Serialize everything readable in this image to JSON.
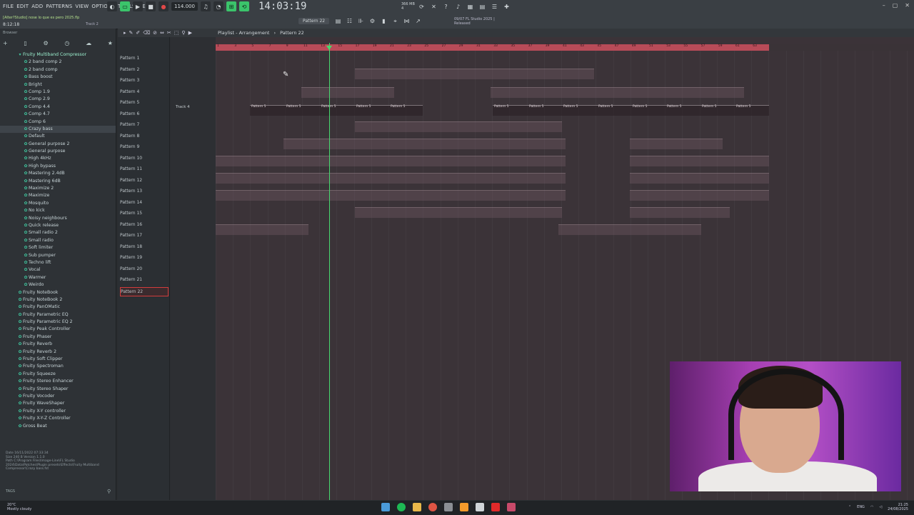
{
  "menu": [
    "FILE",
    "EDIT",
    "ADD",
    "PATTERNS",
    "VIEW",
    "OPTIONS",
    "TOOLS",
    "HELP"
  ],
  "hint": "[Alter?Studio] nose lo que es pero 2025.flp",
  "time_small": "8:12:18",
  "track_label_top": "Track 2",
  "tempo": "114.000",
  "clock": "14:03:19",
  "pattern_selector": "Pattern 22",
  "cpu": [
    "366 MB",
    "4"
  ],
  "news": [
    "09/07 FL Studio 2025 |",
    "Released"
  ],
  "browser": {
    "title": "Browser",
    "head_item": "Fruity Multiband Compressor",
    "presets": [
      "2 band comp 2",
      "2 band comp",
      "Bass boost",
      "Bright",
      "Comp 1.9",
      "Comp 2.9",
      "Comp 4.4",
      "Comp 4.7",
      "Comp 6",
      "Crazy bass",
      "Default",
      "General purpose 2",
      "General purpose",
      "High 4kHz",
      "High bypass",
      "Mastering 2.4dB",
      "Mastering 6dB",
      "Maximize 2",
      "Maximize",
      "Mosquito",
      "No kick",
      "Noisy neighbours",
      "Quick release",
      "Small radio 2",
      "Small radio",
      "Soft limiter",
      "Sub pumper",
      "Techno lift",
      "Vocal",
      "Warmer",
      "Weirdo"
    ],
    "selected": "Crazy bass",
    "plugins": [
      "Fruity NoteBook",
      "Fruity NoteBook 2",
      "Fruity PanOMatic",
      "Fruity Parametric EQ",
      "Fruity Parametric EQ 2",
      "Fruity Peak Controller",
      "Fruity Phaser",
      "Fruity Reverb",
      "Fruity Reverb 2",
      "Fruity Soft Clipper",
      "Fruity Spectroman",
      "Fruity Squeeze",
      "Fruity Stereo Enhancer",
      "Fruity Stereo Shaper",
      "Fruity Vocoder",
      "Fruity WaveShaper",
      "Fruity X-Y controller",
      "Fruity X-Y-Z Controller",
      "Gross Beat"
    ],
    "file_info": [
      "Date 16/11/2022 07:33:34",
      "Size 240 B   Version 1.1.0",
      "Path C:\\Program Files\\Image-Line\\FL Studio 2024\\Data\\Patches\\Plugin presets\\Effects\\Fruity Multiband Compressor\\Crazy bass.fst"
    ],
    "tags_label": "TAGS"
  },
  "playlist": {
    "title": "Playlist - Arrangement",
    "pattern": "Pattern 22",
    "patterns": [
      "Pattern 1",
      "Pattern 2",
      "Pattern 3",
      "Pattern 4",
      "Pattern 5",
      "Pattern 6",
      "Pattern 7",
      "Pattern 8",
      "Pattern 9",
      "Pattern 10",
      "Pattern 11",
      "Pattern 12",
      "Pattern 13",
      "Pattern 14",
      "Pattern 15",
      "Pattern 16",
      "Pattern 17",
      "Pattern 18",
      "Pattern 19",
      "Pattern 20",
      "Pattern 21",
      "Pattern 22"
    ],
    "selected_pattern": "Pattern 22",
    "track4": "Track 4",
    "ruler": [
      "1",
      "3",
      "5",
      "7",
      "9",
      "11",
      "13",
      "15",
      "17",
      "19",
      "21",
      "23",
      "25",
      "27",
      "29",
      "31",
      "33",
      "35",
      "37",
      "39",
      "41",
      "43",
      "45",
      "47",
      "49",
      "51",
      "53",
      "55",
      "57",
      "59",
      "61",
      "63"
    ],
    "clip_row_label": "Pattern 5"
  },
  "taskbar": {
    "weather": [
      "20°C",
      "Mostly cloudy"
    ],
    "lang": "ENG",
    "time": "21:25",
    "date": "24/08/2025"
  },
  "colors": {
    "accent": "#47d86f",
    "ruler": "#b84b58",
    "selection": "#d33c3c"
  }
}
